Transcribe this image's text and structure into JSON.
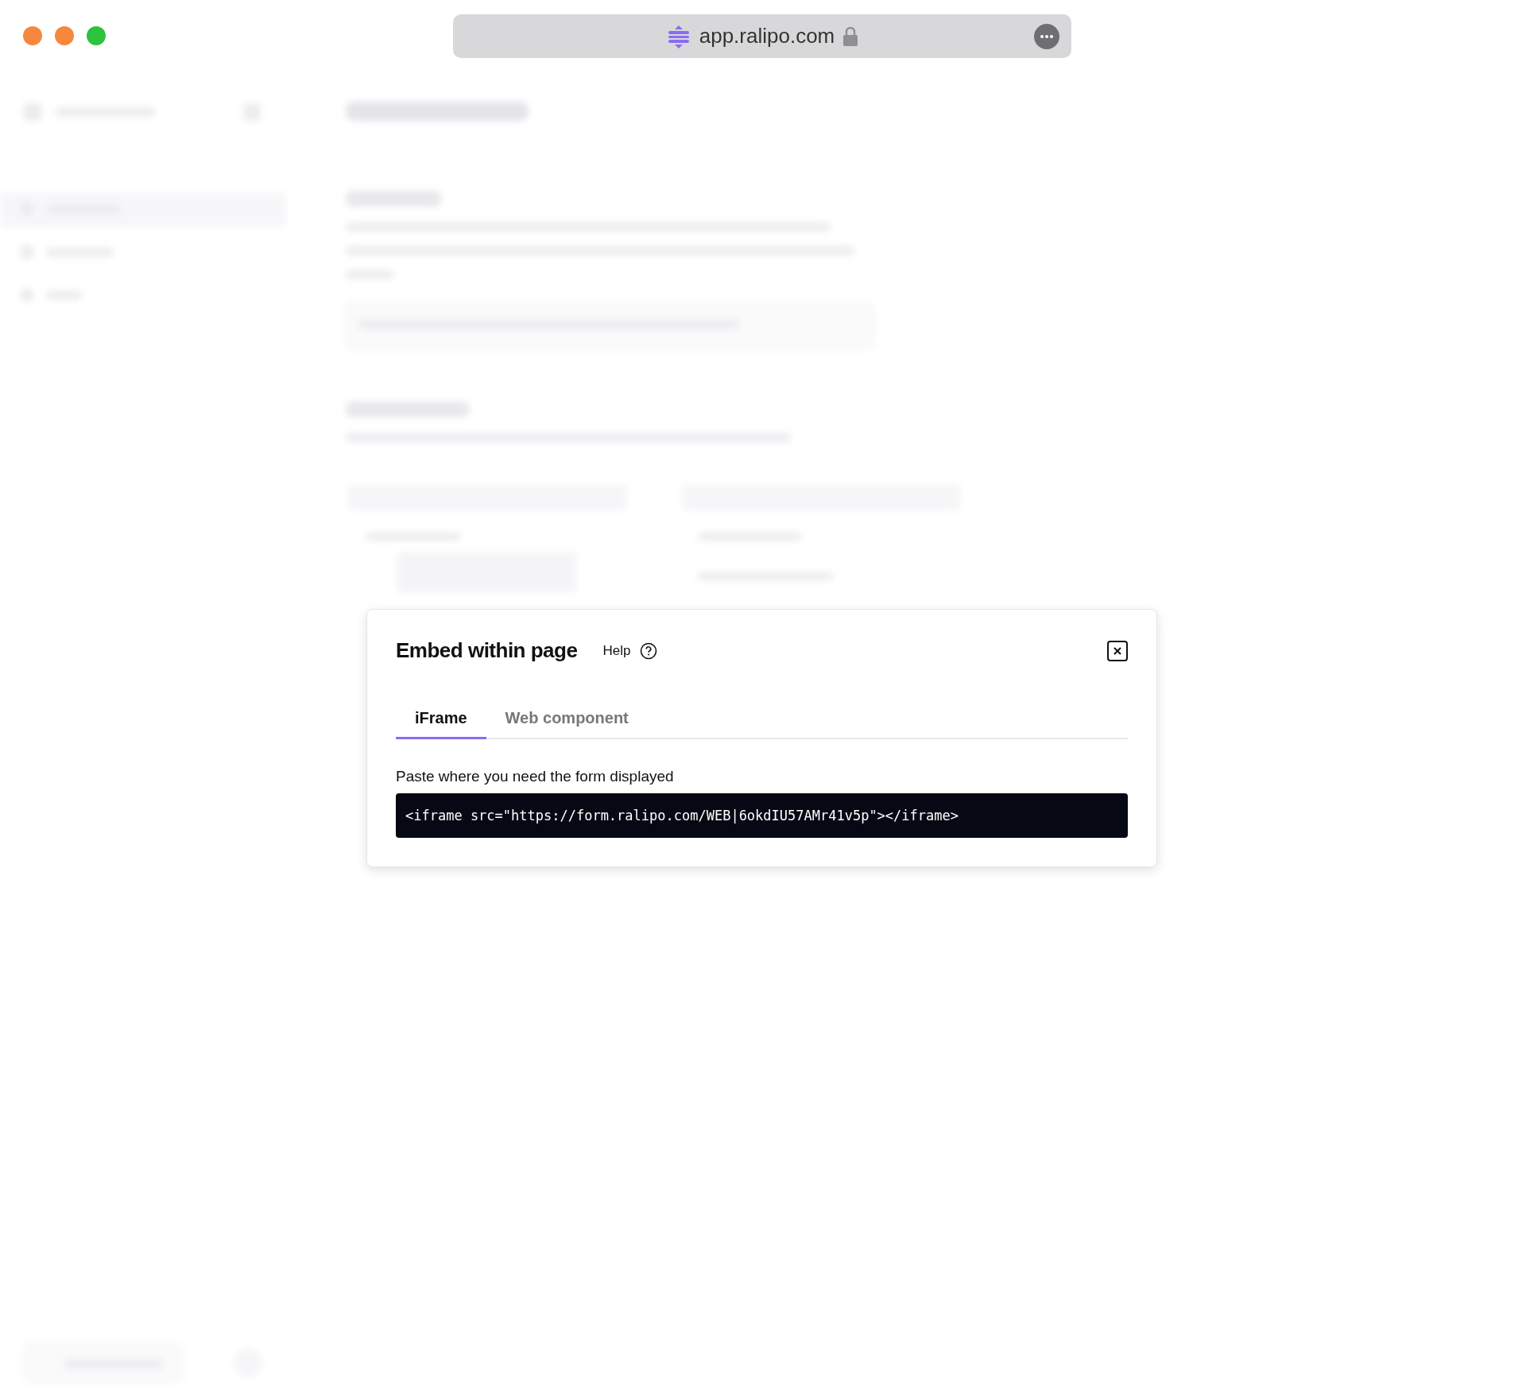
{
  "browser": {
    "address": "app.ralipo.com"
  },
  "dialog": {
    "title": "Embed within page",
    "help": "Help",
    "tabs": [
      {
        "label": "iFrame",
        "selected": true
      },
      {
        "label": "Web component",
        "selected": false
      }
    ],
    "instruction": "Paste where you need the form displayed",
    "code": "<iframe src=\"https://form.ralipo.com/WEB|6okdIU57AMr41v5p\"></iframe>"
  }
}
